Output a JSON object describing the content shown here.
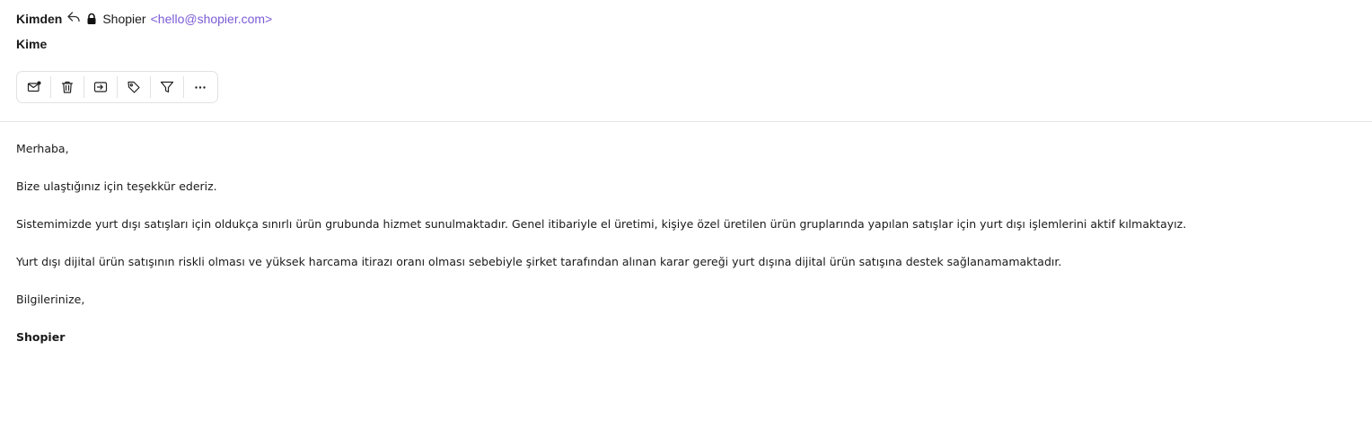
{
  "header": {
    "from_label": "Kimden",
    "sender_name": "Shopier",
    "sender_email": "<hello@shopier.com>",
    "to_label": "Kime"
  },
  "toolbar": {
    "items": [
      {
        "name": "mark-unread",
        "icon": "mail-dot-icon"
      },
      {
        "name": "delete",
        "icon": "trash-icon"
      },
      {
        "name": "move",
        "icon": "move-to-folder-icon"
      },
      {
        "name": "tag",
        "icon": "tag-icon"
      },
      {
        "name": "filter",
        "icon": "filter-icon"
      },
      {
        "name": "more",
        "icon": "more-horizontal-icon"
      }
    ]
  },
  "message": {
    "greeting": "Merhaba,",
    "p1": "Bize ulaştığınız için teşekkür ederiz.",
    "p2": "Sistemimizde yurt dışı satışları için oldukça sınırlı ürün grubunda hizmet sunulmaktadır. Genel itibariyle el üretimi, kişiye özel üretilen ürün gruplarında yapılan satışlar için yurt dışı işlemlerini aktif kılmaktayız.",
    "p3": "Yurt dışı dijital ürün satışının riskli olması ve yüksek harcama itirazı oranı olması sebebiyle şirket tarafından alınan karar gereği yurt dışına dijital ürün satışına destek sağlanamamaktadır.",
    "closing": "Bilgilerinize,",
    "signature": "Shopier"
  },
  "colors": {
    "accent": "#7b5cd6",
    "border": "#e2e2e2"
  }
}
